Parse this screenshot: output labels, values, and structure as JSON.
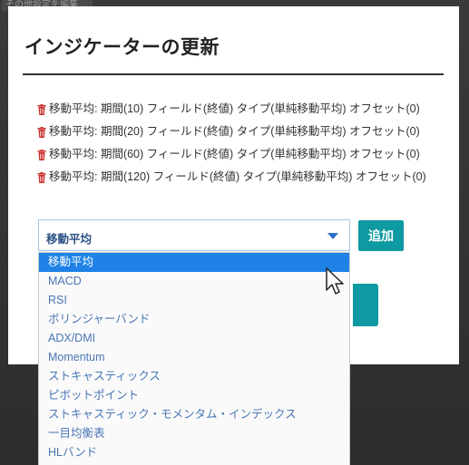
{
  "background": {
    "tab_label": "その他設定を編集"
  },
  "modal": {
    "title": "インジケーターの更新",
    "indicators": [
      {
        "text": "移動平均: 期間(10) フィールド(終値) タイプ(単純移動平均) オフセット(0)"
      },
      {
        "text": "移動平均: 期間(20) フィールド(終値) タイプ(単純移動平均) オフセット(0)"
      },
      {
        "text": "移動平均: 期間(60) フィールド(終値) タイプ(単純移動平均) オフセット(0)"
      },
      {
        "text": "移動平均: 期間(120) フィールド(終値) タイプ(単純移動平均) オフセット(0)"
      }
    ],
    "select": {
      "value": "移動平均",
      "options": [
        "移動平均",
        "MACD",
        "RSI",
        "ボリンジャーバンド",
        "ADX/DMI",
        "Momentum",
        "ストキャスティックス",
        "ピボットポイント",
        "ストキャスティック・モメンタム・インデックス",
        "一目均衡表",
        "HLバンド"
      ],
      "highlighted_index": 0
    },
    "add_label": "追加"
  },
  "colors": {
    "accent": "#0d9aa0",
    "highlight": "#1e82e6",
    "trash": "#c9302c"
  },
  "icons": {
    "delete": "trash-icon",
    "dropdown": "caret-down-icon",
    "pointer": "mouse-cursor-icon"
  }
}
